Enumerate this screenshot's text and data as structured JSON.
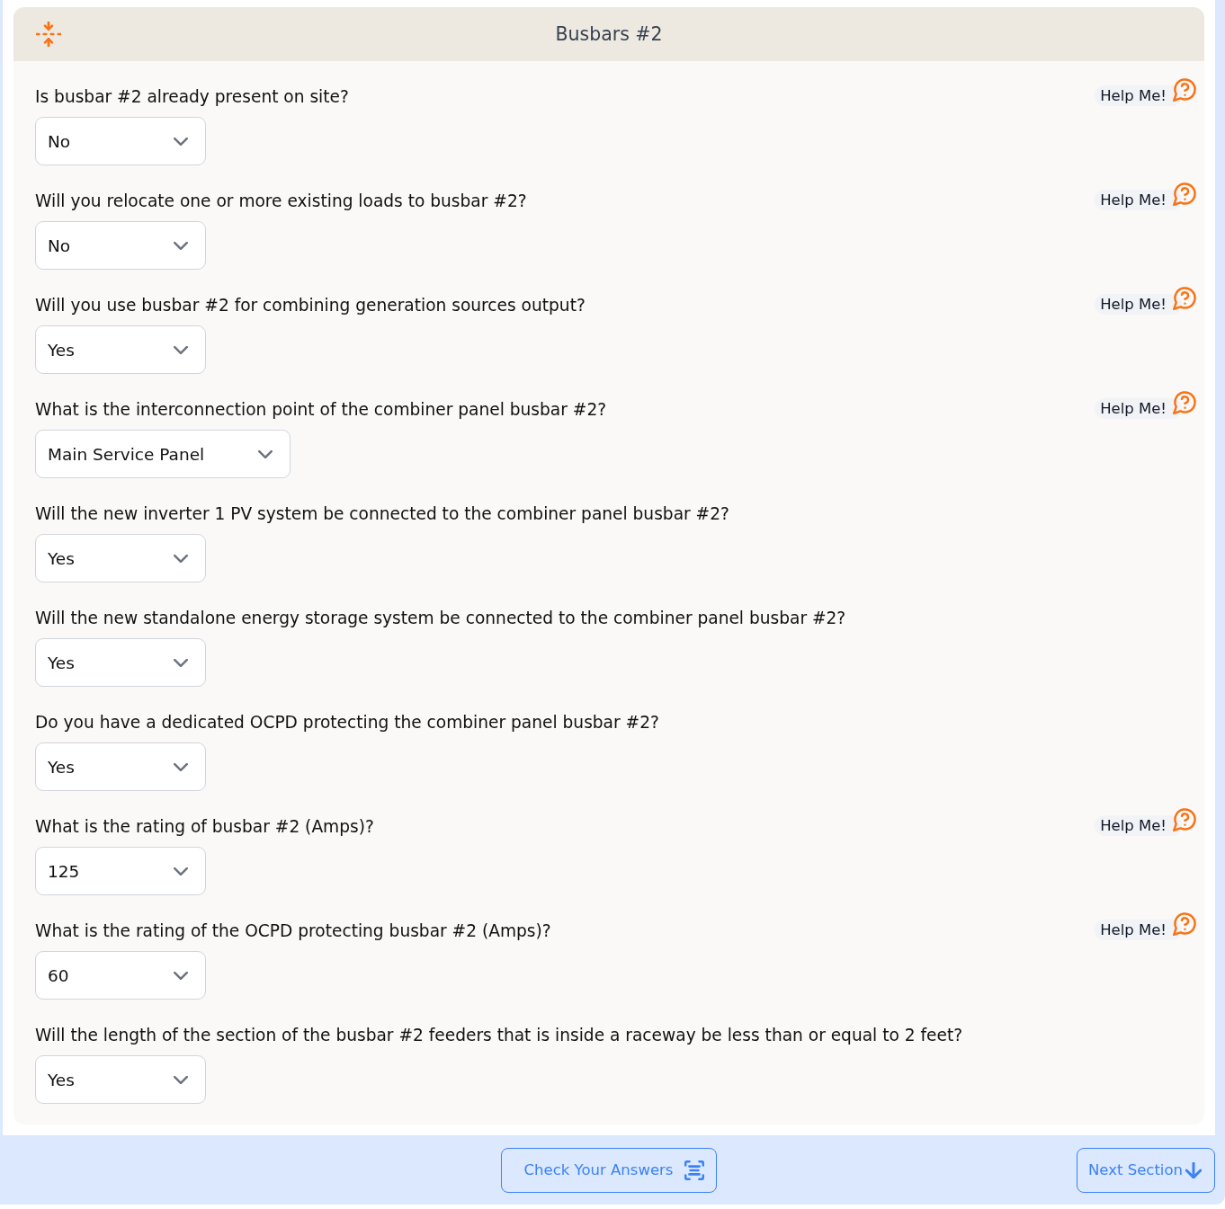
{
  "header": {
    "title": "Busbars #2"
  },
  "questions": [
    {
      "label": "Is busbar #2 already present on site?",
      "answer": "No",
      "help": "Help Me!"
    },
    {
      "label": "Will you relocate one or more existing loads to busbar #2?",
      "answer": "No",
      "help": "Help Me!"
    },
    {
      "label": "Will you use busbar #2 for combining generation sources output?",
      "answer": "Yes",
      "help": "Help Me!"
    },
    {
      "label": "What is the interconnection point of the combiner panel busbar #2?",
      "answer": "Main Service Panel",
      "help": "Help Me!"
    },
    {
      "label": "Will the new inverter 1 PV system be connected to the combiner panel busbar #2?",
      "answer": "Yes"
    },
    {
      "label": "Will the new standalone energy storage system be connected to the combiner panel busbar #2?",
      "answer": "Yes"
    },
    {
      "label": "Do you have a dedicated OCPD protecting the combiner panel busbar #2?",
      "answer": "Yes"
    },
    {
      "label": "What is the rating of busbar #2 (Amps)?",
      "answer": "125",
      "help": "Help Me!"
    },
    {
      "label": "What is the rating of the OCPD protecting busbar #2 (Amps)?",
      "answer": "60",
      "help": "Help Me!"
    },
    {
      "label": "Will the length of the section of the busbar #2 feeders that is inside a raceway be less than or equal to 2 feet?",
      "answer": "Yes"
    }
  ],
  "footer": {
    "buttons": [
      {
        "label": "Check Your Answers",
        "kind": "check"
      },
      {
        "label": "Next Section",
        "kind": "next"
      }
    ]
  }
}
